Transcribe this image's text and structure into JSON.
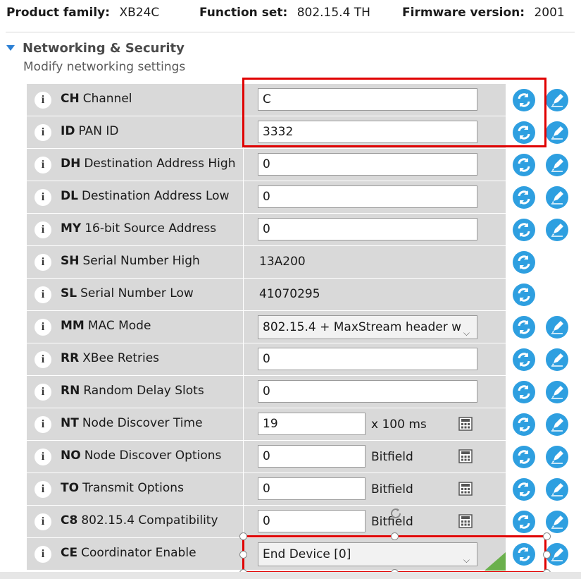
{
  "header": {
    "product_family_label": "Product family:",
    "product_family_value": "XB24C",
    "function_set_label": "Function set:",
    "function_set_value": "802.15.4 TH",
    "firmware_label": "Firmware version:",
    "firmware_value": "2001"
  },
  "section": {
    "title": "Networking & Security",
    "subtitle": "Modify networking settings"
  },
  "info_glyph": "i",
  "rows": [
    {
      "code": "CH",
      "name": "Channel",
      "kind": "input",
      "value": "C"
    },
    {
      "code": "ID",
      "name": "PAN ID",
      "kind": "input",
      "value": "3332"
    },
    {
      "code": "DH",
      "name": "Destination Address High",
      "kind": "input",
      "value": "0"
    },
    {
      "code": "DL",
      "name": "Destination Address Low",
      "kind": "input",
      "value": "0"
    },
    {
      "code": "MY",
      "name": "16-bit Source Address",
      "kind": "input",
      "value": "0"
    },
    {
      "code": "SH",
      "name": "Serial Number High",
      "kind": "readonly",
      "value": "13A200"
    },
    {
      "code": "SL",
      "name": "Serial Number Low",
      "kind": "readonly",
      "value": "41070295"
    },
    {
      "code": "MM",
      "name": "MAC Mode",
      "kind": "select",
      "value": "802.15.4 + MaxStream header w"
    },
    {
      "code": "RR",
      "name": "XBee Retries",
      "kind": "input",
      "value": "0"
    },
    {
      "code": "RN",
      "name": "Random Delay Slots",
      "kind": "input",
      "value": "0"
    },
    {
      "code": "NT",
      "name": "Node Discover Time",
      "kind": "input-unit",
      "value": "19",
      "unit": "x 100 ms"
    },
    {
      "code": "NO",
      "name": "Node Discover Options",
      "kind": "input-unit",
      "value": "0",
      "unit": "Bitfield"
    },
    {
      "code": "TO",
      "name": "Transmit Options",
      "kind": "input-unit",
      "value": "0",
      "unit": "Bitfield"
    },
    {
      "code": "C8",
      "name": "802.15.4 Compatibility",
      "kind": "input-unit",
      "value": "0",
      "unit": "Bitfield"
    },
    {
      "code": "CE",
      "name": "Coordinator Enable",
      "kind": "select",
      "value": "End Device [0]"
    }
  ],
  "icons": {
    "read": "refresh-icon",
    "write": "pencil-icon",
    "calculator": "calculator-icon",
    "chevron": "chevron-down-icon"
  },
  "colors": {
    "accent_blue": "#2e9fe0",
    "highlight_red": "#e00000",
    "row_gray": "#d9d9d9"
  }
}
